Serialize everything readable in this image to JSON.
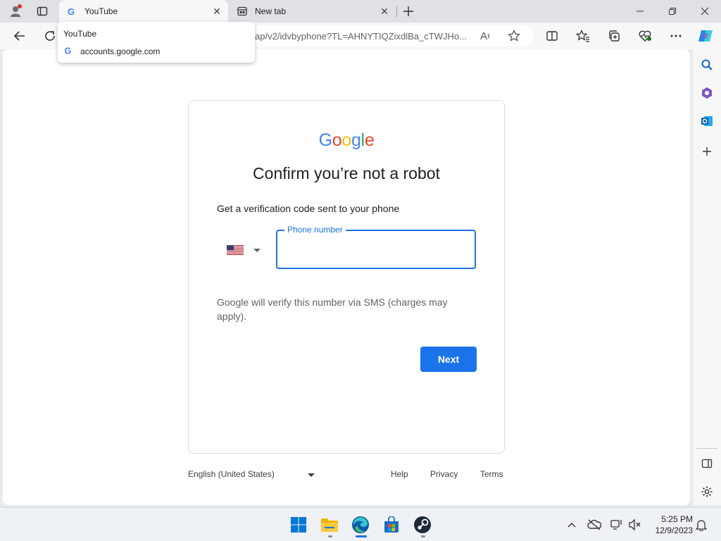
{
  "browser": {
    "tabs": [
      {
        "title": "YouTube",
        "active": true
      },
      {
        "title": "New tab",
        "active": false
      }
    ],
    "address_bar": {
      "url": "ap/v2/idvbyphone?TL=AHNYTIQZixdlBa_cTWJHo..."
    },
    "hover_card": {
      "title": "YouTube",
      "url": "accounts.google.com"
    }
  },
  "page": {
    "logo_letters": [
      {
        "char": "G",
        "color": "#4285F4"
      },
      {
        "char": "o",
        "color": "#EA4335"
      },
      {
        "char": "o",
        "color": "#FBBC05"
      },
      {
        "char": "g",
        "color": "#4285F4"
      },
      {
        "char": "l",
        "color": "#34A853"
      },
      {
        "char": "e",
        "color": "#EA4335"
      }
    ],
    "heading": "Confirm you’re not a robot",
    "subtext": "Get a verification code sent to your phone",
    "country_flag": "us-flag-icon",
    "phone_label": "Phone number",
    "phone_value": "",
    "sms_note": "Google will verify this number via SMS (charges may apply).",
    "next_button": "Next",
    "accent_color": "#1a73e8"
  },
  "footer": {
    "language": "English (United States)",
    "links": [
      "Help",
      "Privacy",
      "Terms"
    ]
  },
  "taskbar": {
    "time": "5:25 PM",
    "date": "12/9/2023"
  }
}
